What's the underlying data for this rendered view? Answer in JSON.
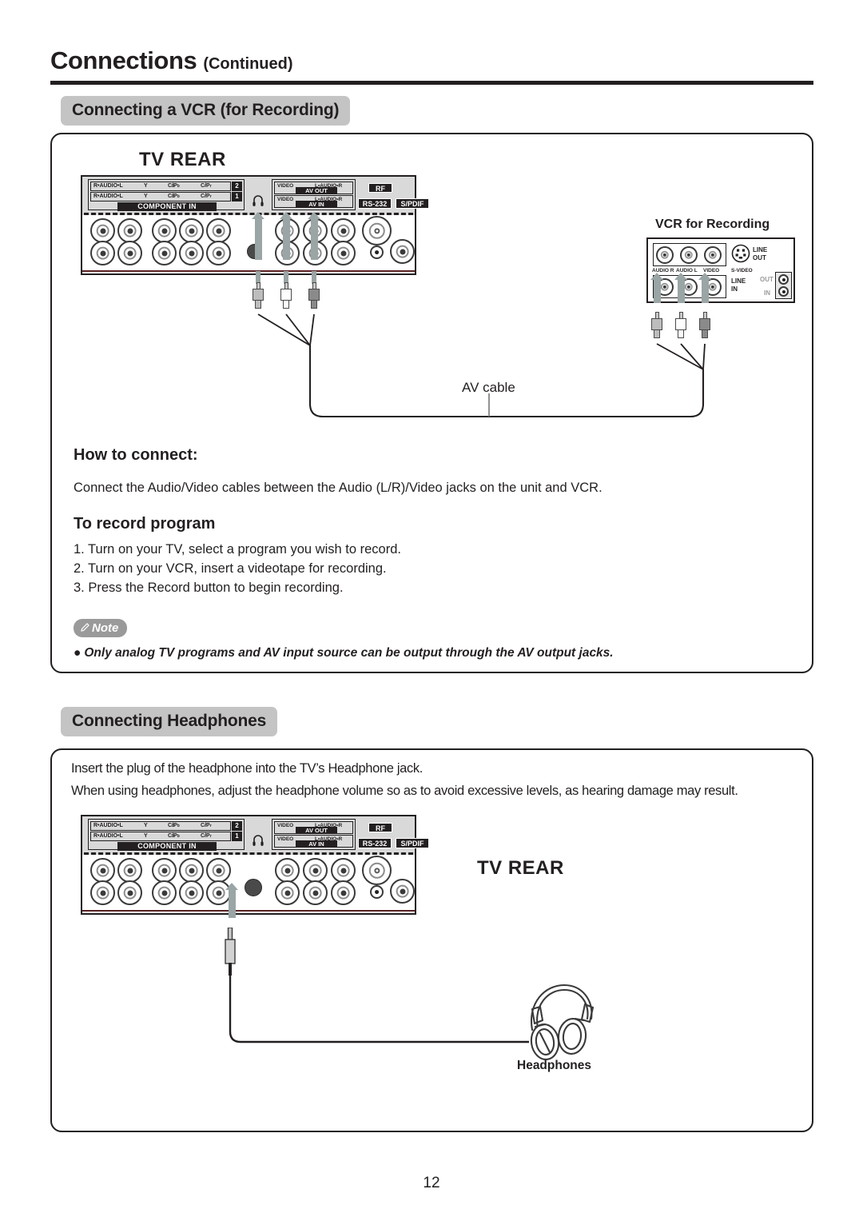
{
  "page": {
    "title": "Connections",
    "title_suffix": "(Continued)",
    "number": "12"
  },
  "sections": [
    {
      "chip": "Connecting a VCR (for Recording)"
    },
    {
      "chip": "Connecting Headphones"
    }
  ],
  "vcr_section": {
    "tv_rear_label": "TV REAR",
    "vcr_label": "VCR for Recording",
    "av_cable_label": "AV cable",
    "how_to_connect_heading": "How to connect:",
    "how_to_connect_body": "Connect the Audio/Video cables between the Audio (L/R)/Video jacks on the unit and VCR.",
    "record_heading": "To record program",
    "steps": [
      "1. Turn on your TV, select a program you wish to record.",
      "2. Turn on your VCR, insert a videotape for recording.",
      "3. Press the Record button to begin recording."
    ],
    "note": {
      "badge": "Note",
      "bullet": "●",
      "text": "Only analog TV programs and AV input source can be output through the AV output jacks."
    }
  },
  "headphone_section": {
    "tv_rear_label": "TV REAR",
    "lines": [
      "Insert the plug of the headphone into the TV’s Headphone jack.",
      "When using headphones, adjust the headphone volume so as to avoid excessive levels, as hearing damage may result."
    ],
    "headphones_caption": "Headphones"
  },
  "tv_panel": {
    "component": {
      "rows": [
        {
          "audio": "R•AUDIO•L",
          "y": "Y",
          "cb": "C",
          "cb_sub": "b",
          "cb_2": "/P",
          "cb_sub2": "b",
          "cr": "C",
          "cr_sub": "r",
          "cr_2": "/P",
          "cr_sub2": "r",
          "num": "2"
        },
        {
          "audio": "R•AUDIO•L",
          "y": "Y",
          "cb": "C",
          "cb_sub": "b",
          "cb_2": "/P",
          "cb_sub2": "b",
          "cr": "C",
          "cr_sub": "r",
          "cr_2": "/P",
          "cr_sub2": "r",
          "num": "1"
        }
      ],
      "caption": "COMPONENT IN"
    },
    "av": {
      "rows": [
        {
          "video": "VIDEO",
          "audio": "L•AUDIO•R",
          "tag": "AV OUT"
        },
        {
          "video": "VIDEO",
          "audio": "L•AUDIO•R",
          "tag": "AV IN"
        }
      ]
    },
    "tags": {
      "rf": "RF",
      "rs232": "RS-232",
      "spdif": "S/PDIF"
    }
  },
  "vcr_panel": {
    "top_jack_labels": [
      "AUDIO R",
      "AUDIO L",
      "VIDEO"
    ],
    "svideo_label": "S-VIDEO",
    "line_out": "LINE\nOUT",
    "line_out_l1": "LINE",
    "line_out_l2": "OUT",
    "line_in_l1": "LINE",
    "line_in_l2": "IN",
    "rf_out": "OUT",
    "rf_in": "IN"
  },
  "colors": {
    "chip_bg": "#c4c4c4",
    "panel_border": "#231f20",
    "note_badge_bg": "#9a9a9a",
    "arrow": "#9aa5a5",
    "panel_fill": "#d9d9d9"
  }
}
